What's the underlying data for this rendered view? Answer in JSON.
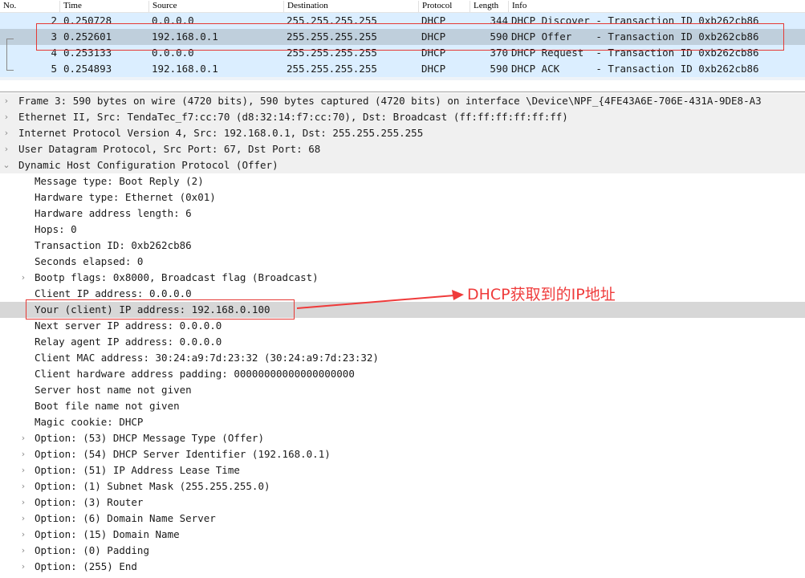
{
  "packet_list": {
    "columns": [
      "No.",
      "Time",
      "Source",
      "Destination",
      "Protocol",
      "Length",
      "Info"
    ],
    "rows": [
      {
        "no": "2",
        "time": "0.250728",
        "source": "0.0.0.0",
        "destination": "255.255.255.255",
        "protocol": "DHCP",
        "length": "344",
        "info": "DHCP Discover - Transaction ID 0xb262cb86"
      },
      {
        "no": "3",
        "time": "0.252601",
        "source": "192.168.0.1",
        "destination": "255.255.255.255",
        "protocol": "DHCP",
        "length": "590",
        "info": "DHCP Offer    - Transaction ID 0xb262cb86",
        "selected": true
      },
      {
        "no": "4",
        "time": "0.253133",
        "source": "0.0.0.0",
        "destination": "255.255.255.255",
        "protocol": "DHCP",
        "length": "370",
        "info": "DHCP Request  - Transaction ID 0xb262cb86"
      },
      {
        "no": "5",
        "time": "0.254893",
        "source": "192.168.0.1",
        "destination": "255.255.255.255",
        "protocol": "DHCP",
        "length": "590",
        "info": "DHCP ACK      - Transaction ID 0xb262cb86"
      }
    ]
  },
  "details": {
    "top_level": [
      {
        "text": "Frame 3: 590 bytes on wire (4720 bits), 590 bytes captured (4720 bits) on interface \\Device\\NPF_{4FE43A6E-706E-431A-9DE8-A3",
        "expanded": false
      },
      {
        "text": "Ethernet II, Src: TendaTec_f7:cc:70 (d8:32:14:f7:cc:70), Dst: Broadcast (ff:ff:ff:ff:ff:ff)",
        "expanded": false
      },
      {
        "text": "Internet Protocol Version 4, Src: 192.168.0.1, Dst: 255.255.255.255",
        "expanded": false
      },
      {
        "text": "User Datagram Protocol, Src Port: 67, Dst Port: 68",
        "expanded": false
      },
      {
        "text": "Dynamic Host Configuration Protocol (Offer)",
        "expanded": true
      }
    ],
    "dhcp_fields": [
      {
        "text": "Message type: Boot Reply (2)",
        "expandable": false
      },
      {
        "text": "Hardware type: Ethernet (0x01)",
        "expandable": false
      },
      {
        "text": "Hardware address length: 6",
        "expandable": false
      },
      {
        "text": "Hops: 0",
        "expandable": false
      },
      {
        "text": "Transaction ID: 0xb262cb86",
        "expandable": false
      },
      {
        "text": "Seconds elapsed: 0",
        "expandable": false
      },
      {
        "text": "Bootp flags: 0x8000, Broadcast flag (Broadcast)",
        "expandable": true
      },
      {
        "text": "Client IP address: 0.0.0.0",
        "expandable": false
      },
      {
        "text": "Your (client) IP address: 192.168.0.100",
        "expandable": false,
        "highlighted": true
      },
      {
        "text": "Next server IP address: 0.0.0.0",
        "expandable": false
      },
      {
        "text": "Relay agent IP address: 0.0.0.0",
        "expandable": false
      },
      {
        "text": "Client MAC address: 30:24:a9:7d:23:32 (30:24:a9:7d:23:32)",
        "expandable": false
      },
      {
        "text": "Client hardware address padding: 00000000000000000000",
        "expandable": false
      },
      {
        "text": "Server host name not given",
        "expandable": false
      },
      {
        "text": "Boot file name not given",
        "expandable": false
      },
      {
        "text": "Magic cookie: DHCP",
        "expandable": false
      },
      {
        "text": "Option: (53) DHCP Message Type (Offer)",
        "expandable": true
      },
      {
        "text": "Option: (54) DHCP Server Identifier (192.168.0.1)",
        "expandable": true
      },
      {
        "text": "Option: (51) IP Address Lease Time",
        "expandable": true
      },
      {
        "text": "Option: (1) Subnet Mask (255.255.255.0)",
        "expandable": true
      },
      {
        "text": "Option: (3) Router",
        "expandable": true
      },
      {
        "text": "Option: (6) Domain Name Server",
        "expandable": true
      },
      {
        "text": "Option: (15) Domain Name",
        "expandable": true
      },
      {
        "text": "Option: (0) Padding",
        "expandable": true
      },
      {
        "text": "Option: (255) End",
        "expandable": true
      }
    ]
  },
  "icons": {
    "collapsed": "›",
    "expanded": "⌄"
  },
  "annotation": {
    "label": "DHCP获取到的IP地址",
    "color": "#ef3b3b"
  }
}
